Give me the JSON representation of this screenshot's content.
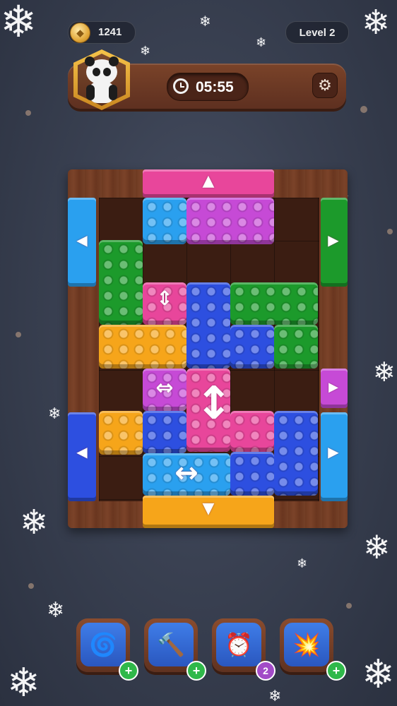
{
  "hud": {
    "coins": "1241",
    "level": "Level 2",
    "timer": "05:55",
    "settings_icon": "gear-icon",
    "avatar_icon": "panda-avatar"
  },
  "boosters": [
    {
      "name": "drill-booster",
      "icon": "drill-icon",
      "badge": "+"
    },
    {
      "name": "hammer-booster",
      "icon": "hammer-icon",
      "badge": "+"
    },
    {
      "name": "freeze-clock-booster",
      "icon": "alarm-clock-icon",
      "badge": "2"
    },
    {
      "name": "cannon-booster",
      "icon": "cannon-icon",
      "badge": "+"
    }
  ],
  "colors": {
    "pink": "#e8469b",
    "purple": "#c64ad6",
    "blue": "#2d4fe0",
    "light_blue": "#2aa0ef",
    "green": "#1c9a2b",
    "yellow": "#f6a51a"
  }
}
